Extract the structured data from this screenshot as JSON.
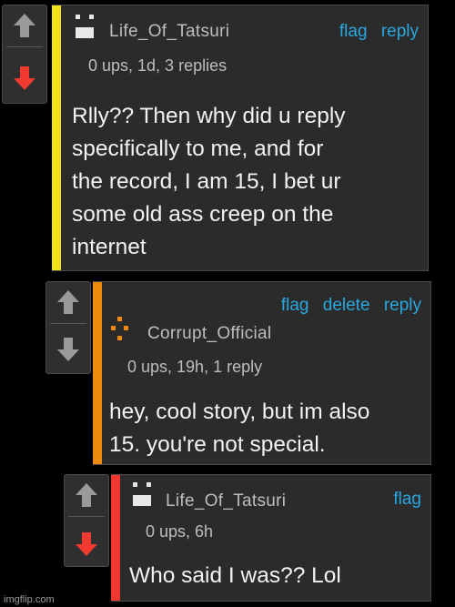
{
  "colors": {
    "background": "#000000",
    "card": "#2b2b2b",
    "link": "#29a8e0",
    "up_arrow": "#9a9a9a",
    "down_arrow_active": "#f03a30",
    "down_arrow_inactive": "#9a9a9a"
  },
  "comments": [
    {
      "username": "Life_Of_Tatsuri",
      "meta": "0 ups, 1d, 3 replies",
      "body": "Rlly?? Then why did u reply\nspecifically to me, and for\nthe record, I am 15, I bet ur\nsome old ass creep on the\ninternet",
      "actions": {
        "flag": "flag",
        "reply": "reply"
      },
      "stripe_color": "#f2e21a",
      "avatar_color": "#e8e8e8",
      "upvoted": false,
      "downvoted": true
    },
    {
      "username": "Corrupt_Official",
      "meta": "0 ups, 19h, 1 reply",
      "body": "hey, cool story, but im also\n15. you're not special.",
      "actions": {
        "flag": "flag",
        "delete": "delete",
        "reply": "reply"
      },
      "stripe_color": "#f08a0c",
      "avatar_color": "#f08a0c",
      "upvoted": false,
      "downvoted": false
    },
    {
      "username": "Life_Of_Tatsuri",
      "meta": "0 ups, 6h",
      "body": "Who said I was?? Lol",
      "actions": {
        "flag": "flag"
      },
      "stripe_color": "#f0382e",
      "avatar_color": "#e8e8e8",
      "upvoted": false,
      "downvoted": true
    }
  ],
  "icons": {
    "upvote": "arrow-up-icon",
    "downvote": "arrow-down-icon",
    "avatar": "user-avatar-icon"
  },
  "watermark": "imgflip.com"
}
